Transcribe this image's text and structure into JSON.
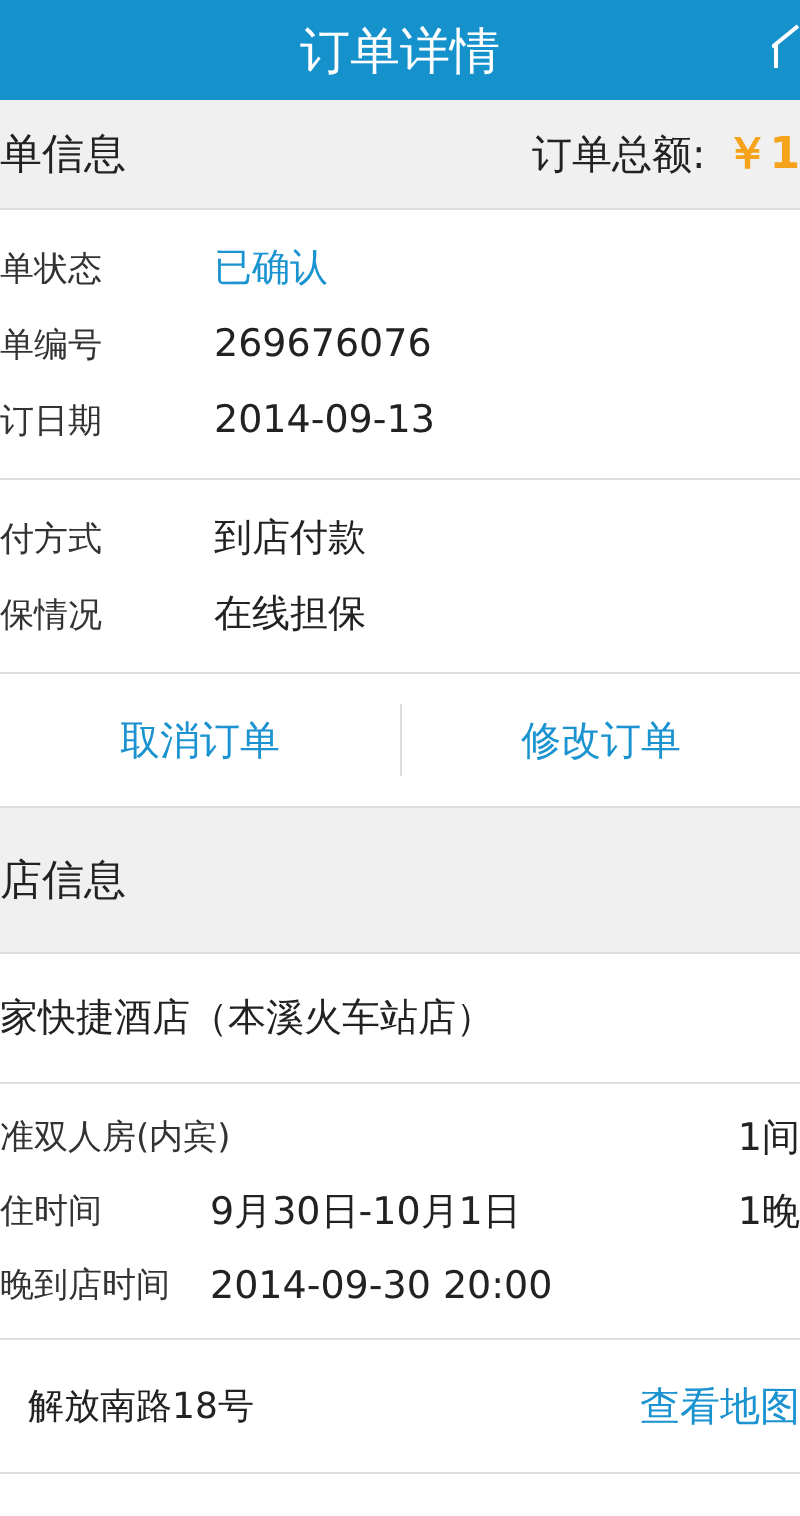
{
  "header": {
    "title": "订单详情"
  },
  "order_section": {
    "title": "单信息",
    "total_label": "订单总额:",
    "total_value": "￥1"
  },
  "order_rows": [
    {
      "label": "单状态",
      "value": "已确认",
      "kind": "status"
    },
    {
      "label": "单编号",
      "value": "269676076",
      "kind": "plain"
    },
    {
      "label": "订日期",
      "value": "2014-09-13",
      "kind": "plain"
    }
  ],
  "payment_rows": [
    {
      "label": "付方式",
      "value": "到店付款"
    },
    {
      "label": "保情况",
      "value": "在线担保"
    }
  ],
  "actions": [
    "取消订单",
    "修改订单"
  ],
  "hotel_section": {
    "title": "店信息"
  },
  "hotel_name": "家快捷酒店（本溪火车站店）",
  "stay_rows": [
    {
      "label": "准双人房(内宾)",
      "extra": "1间"
    },
    {
      "label": "住时间",
      "value": "9月30日-10月1日",
      "extra": "1晚"
    },
    {
      "label": "晚到店时间",
      "value": "2014-09-30 20:00"
    }
  ],
  "address": {
    "text": "解放南路18号",
    "link": "查看地图"
  }
}
